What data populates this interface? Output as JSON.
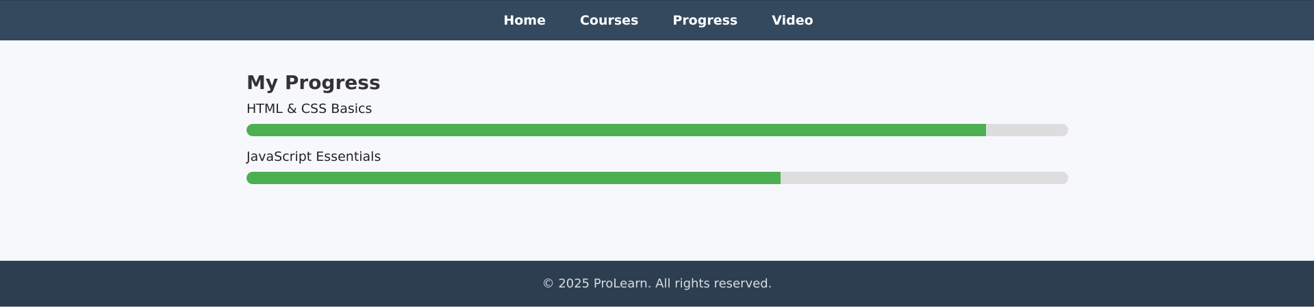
{
  "nav": {
    "items": [
      {
        "label": "Home"
      },
      {
        "label": "Courses"
      },
      {
        "label": "Progress"
      },
      {
        "label": "Video"
      }
    ]
  },
  "main": {
    "title": "My Progress",
    "courses": [
      {
        "name": "HTML & CSS Basics",
        "progress_percent": 90
      },
      {
        "name": "JavaScript Essentials",
        "progress_percent": 65
      }
    ]
  },
  "footer": {
    "text": "© 2025 ProLearn. All rights reserved."
  },
  "colors": {
    "header_background": "#34495e",
    "page_background": "#f7f8fb",
    "progress_fill": "#4caf50",
    "progress_track": "#dddddd",
    "footer_background": "#2c3e50"
  }
}
